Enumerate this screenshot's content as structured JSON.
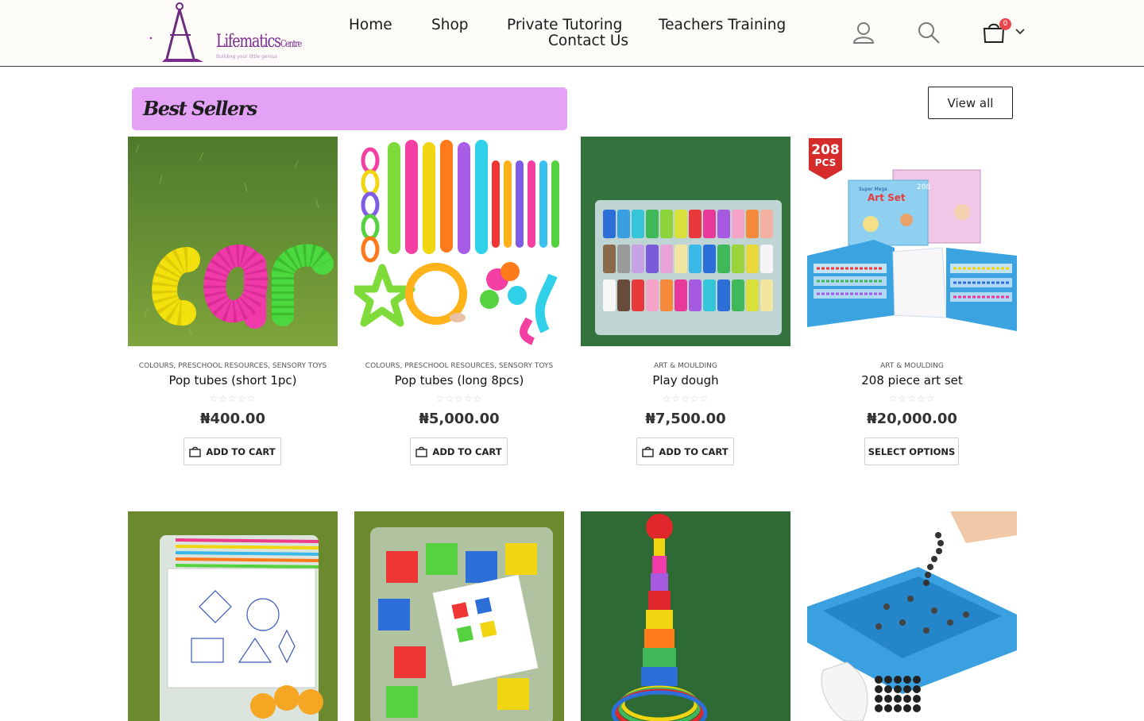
{
  "header": {
    "logo": {
      "name": "Lifematics",
      "name_suffix": "Centre",
      "tagline": "Building your little genius"
    },
    "nav": [
      {
        "label": "Home"
      },
      {
        "label": "Shop"
      },
      {
        "label": "Private Tutoring"
      },
      {
        "label": "Contact Us"
      },
      {
        "label": "Teachers Training"
      }
    ],
    "icons": [
      "user-icon",
      "search-icon",
      "cart-icon",
      "chevron-down-icon"
    ],
    "cart_count": "0"
  },
  "section": {
    "title": "Best Sellers",
    "view_all_label": "View all",
    "banner_color": "#e3a2f6"
  },
  "products": [
    {
      "categories": "Colours, Preschool Resources, Sensory Toys",
      "name": "Pop tubes (short 1pc)",
      "price": "₦400.00",
      "button": "Add to cart",
      "rating": "☆☆☆☆☆"
    },
    {
      "categories": "Colours, Preschool Resources, Sensory Toys",
      "name": "Pop tubes (long 8pcs)",
      "price": "₦5,000.00",
      "button": "Add to cart",
      "rating": "☆☆☆☆☆"
    },
    {
      "categories": "Art & Moulding",
      "name": "Play dough",
      "price": "₦7,500.00",
      "button": "Add to cart",
      "rating": "☆☆☆☆☆"
    },
    {
      "categories": "Art & Moulding",
      "name": "208 piece art set",
      "price": "₦20,000.00",
      "button": "Select options",
      "rating": "☆☆☆☆☆",
      "badge": {
        "line1": "208",
        "line2": "PCS"
      },
      "box_text": {
        "brand": "Super Mega",
        "title": "Art Set",
        "count": "208"
      }
    }
  ]
}
